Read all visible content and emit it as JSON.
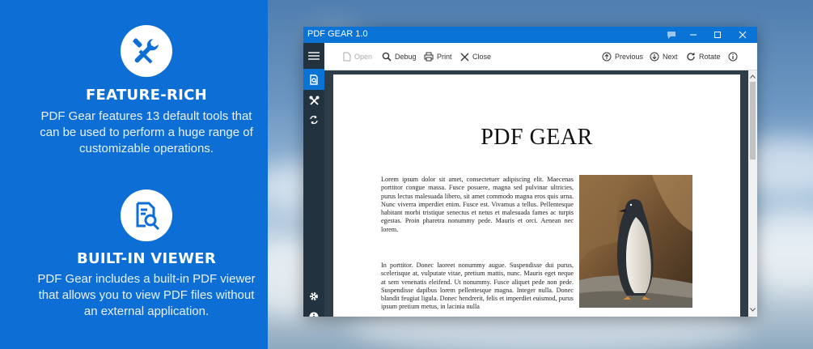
{
  "promo": {
    "feature_rich": {
      "title": "FEATURE-RICH",
      "description": "PDF Gear features 13 default tools that can be used to perform a huge range of customizable operations."
    },
    "built_in_viewer": {
      "title": "BUILT-IN VIEWER",
      "description": "PDF Gear includes a built-in PDF viewer that allows you to view PDF files without an external application."
    }
  },
  "app": {
    "title": "PDF GEAR 1.0",
    "toolbar": {
      "open": "Open",
      "debug": "Debug",
      "print": "Print",
      "close": "Close",
      "previous": "Previous",
      "next": "Next",
      "rotate": "Rotate"
    },
    "document": {
      "title": "PDF GEAR",
      "paragraph_1": "Lorem ipsum dolor sit amet, consectetuer adipiscing elit. Maecenas porttitor congue massa. Fusce posuere, magna sed pulvinar ultricies, purus lectus malesuada libero, sit amet commodo magna eros quis urna. Nunc viverra imperdiet enim. Fusce est. Vivamus a tellus. Pellentesque habitant morbi tristique senectus et netus et malesuada fames ac turpis egestas. Proin pharetra nonummy pede. Mauris et orci. Aenean nec lorem.",
      "paragraph_2": "In porttitor. Donec laoreet nonummy augue. Suspendisse dui purus, scelerisque at, vulputate vitae, pretium mattis, nunc. Mauris eget neque at sem venenatis eleifend. Ut nonummy. Fusce aliquet pede non pede. Suspendisse dapibus lorem pellentesque magna. Integer nulla. Donec blandit feugiat ligula. Donec hendrerit, felis et imperdiet euismod, purus ipsum pretium metus, in lacinia nulla"
    }
  },
  "colors": {
    "promo_bg": "#0d6ed6",
    "titlebar": "#0a74d6",
    "sidebar": "#23323f",
    "doc_bg": "#2f3d48"
  },
  "icons": {
    "feature_rich": "tools-icon",
    "built_in_viewer": "document-search-icon",
    "sidebar": [
      "menu-icon",
      "viewer-icon",
      "tools-icon",
      "rotate-icon",
      "gear-icon",
      "info-icon"
    ]
  }
}
